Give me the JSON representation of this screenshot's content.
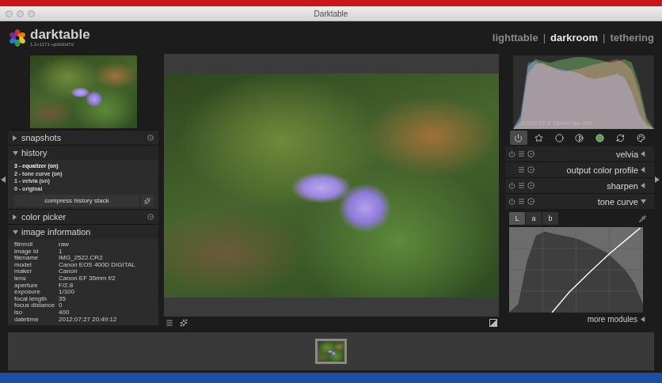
{
  "window": {
    "title": "Darktable"
  },
  "logo": {
    "name": "darktable",
    "version": "1.2+1171~gb0d0d7d"
  },
  "views": [
    {
      "label": "lighttable",
      "selected": false
    },
    {
      "label": "darkroom",
      "selected": true
    },
    {
      "label": "tethering",
      "selected": false
    }
  ],
  "view_separator": "|",
  "left_sections": [
    {
      "kind": "plain",
      "title": "snapshots",
      "expanded": false,
      "reset_icon": true
    },
    {
      "kind": "history",
      "title": "history",
      "expanded": true,
      "reset_icon": false,
      "items": [
        {
          "label": "3 - equalizer (on)",
          "selected": true
        },
        {
          "label": "2 - tone curve (on)",
          "selected": false
        },
        {
          "label": "1 - velvia (on)",
          "selected": false
        },
        {
          "label": "0 - original",
          "selected": false
        }
      ],
      "button": "compress history stack"
    },
    {
      "kind": "plain",
      "title": "color picker",
      "expanded": false,
      "reset_icon": true
    },
    {
      "kind": "info",
      "title": "image information",
      "expanded": true,
      "reset_icon": false,
      "rows": [
        {
          "label": "filmroll",
          "value": "raw"
        },
        {
          "label": "image id",
          "value": "1"
        },
        {
          "label": "filename",
          "value": "IMG_2522.CR2"
        },
        {
          "label": "model",
          "value": "Canon EOS 400D DIGITAL"
        },
        {
          "label": "maker",
          "value": "Canon"
        },
        {
          "label": "lens",
          "value": "Canon EF 35mm f/2"
        },
        {
          "label": "aperture",
          "value": "F/2.8"
        },
        {
          "label": "exposure",
          "value": "1/100"
        },
        {
          "label": "focal length",
          "value": "35"
        },
        {
          "label": "focus distance",
          "value": "0"
        },
        {
          "label": "iso",
          "value": "400"
        },
        {
          "label": "datetime",
          "value": "2012:07:27 20:49:12"
        }
      ]
    }
  ],
  "histogram": {
    "caption": "1/100 f/2.8 35mm iso 400",
    "series": [
      {
        "name": "red",
        "color": "#b84a4a",
        "values": [
          0,
          0.1,
          0.75,
          0.88,
          0.9,
          0.85,
          0.8,
          0.78,
          0.8,
          0.82,
          0.85,
          0.88,
          0.9,
          0.92,
          0.95,
          0.9,
          0.8,
          0.5,
          0.1,
          0
        ]
      },
      {
        "name": "green",
        "color": "#5aa04a",
        "values": [
          0,
          0.15,
          0.85,
          0.95,
          0.92,
          0.9,
          0.93,
          0.95,
          0.97,
          0.98,
          0.97,
          0.95,
          0.93,
          0.9,
          0.92,
          0.95,
          0.9,
          0.6,
          0.15,
          0
        ]
      },
      {
        "name": "blue",
        "color": "#5560c0",
        "values": [
          0,
          0.2,
          0.9,
          0.92,
          0.88,
          0.85,
          0.82,
          0.8,
          0.78,
          0.75,
          0.7,
          0.68,
          0.7,
          0.72,
          0.75,
          0.7,
          0.5,
          0.2,
          0.05,
          0
        ]
      }
    ]
  },
  "module_groups": [
    {
      "selected": true
    },
    {
      "selected": false
    },
    {
      "selected": false
    },
    {
      "selected": false
    },
    {
      "selected": false
    },
    {
      "selected": false
    },
    {
      "selected": false
    }
  ],
  "modules": [
    {
      "name": "velvia",
      "has_power": true,
      "expanded": false
    },
    {
      "name": "output color profile",
      "has_power": false,
      "expanded": false
    },
    {
      "name": "sharpen",
      "has_power": true,
      "expanded": false
    },
    {
      "name": "tone curve",
      "has_power": true,
      "expanded": true
    }
  ],
  "tone_curve": {
    "tabs": [
      {
        "label": "L",
        "selected": true
      },
      {
        "label": "a",
        "selected": false
      },
      {
        "label": "b",
        "selected": false
      }
    ],
    "histogram": [
      0,
      0.1,
      0.6,
      0.9,
      0.95,
      0.92,
      0.9,
      0.88,
      0.85,
      0.8,
      0.75,
      0.7,
      0.6,
      0.5,
      0.35,
      0.1
    ],
    "curve": [
      [
        0.32,
        0
      ],
      [
        0.45,
        0.24
      ],
      [
        0.6,
        0.47
      ],
      [
        0.75,
        0.69
      ],
      [
        0.88,
        0.86
      ],
      [
        0.98,
        0.99
      ]
    ]
  },
  "more_modules": "more modules",
  "filmstrip": [
    {
      "selected": true
    }
  ]
}
